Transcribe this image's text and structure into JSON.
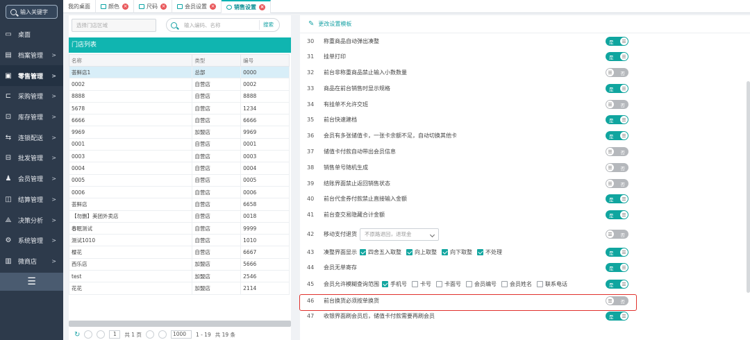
{
  "sidebar": {
    "search_placeholder": "输入关键字",
    "items": [
      {
        "label": "桌面",
        "icon": "desktop-icon",
        "arrow": ""
      },
      {
        "label": "档案管理",
        "icon": "file-icon",
        "arrow": ">"
      },
      {
        "label": "零售管理",
        "icon": "store-icon",
        "arrow": ">"
      },
      {
        "label": "采购管理",
        "icon": "purchase-icon",
        "arrow": ">"
      },
      {
        "label": "库存管理",
        "icon": "inventory-icon",
        "arrow": ">"
      },
      {
        "label": "连锁配送",
        "icon": "delivery-icon",
        "arrow": ">"
      },
      {
        "label": "批发管理",
        "icon": "wholesale-icon",
        "arrow": ">"
      },
      {
        "label": "会员管理",
        "icon": "member-icon",
        "arrow": ">"
      },
      {
        "label": "结算管理",
        "icon": "settlement-icon",
        "arrow": ">"
      },
      {
        "label": "决策分析",
        "icon": "analysis-icon",
        "arrow": ">"
      },
      {
        "label": "系统管理",
        "icon": "gear-icon",
        "arrow": ">"
      },
      {
        "label": "微商店",
        "icon": "shop-icon",
        "arrow": ">"
      }
    ],
    "collapse_glyph": "☰"
  },
  "tabs": [
    {
      "label": "我的桌面",
      "closable": false
    },
    {
      "label": "颜色",
      "closable": true
    },
    {
      "label": "尺码",
      "closable": true
    },
    {
      "label": "会员设置",
      "closable": true
    },
    {
      "label": "销售设置",
      "closable": true
    }
  ],
  "left": {
    "store_select_placeholder": "选择门店区域",
    "search_placeholder": "输入编码、名称",
    "search_button": "搜索",
    "store_list_title": "门店列表",
    "columns": [
      "名称",
      "类型",
      "编号"
    ],
    "rows": [
      [
        "荟鲜店1",
        "总部",
        "0000"
      ],
      [
        "0002",
        "自营店",
        "0002"
      ],
      [
        "8888",
        "自营店",
        "8888"
      ],
      [
        "5678",
        "自营店",
        "1234"
      ],
      [
        "6666",
        "自营店",
        "6666"
      ],
      [
        "9969",
        "加盟店",
        "9969"
      ],
      [
        "0001",
        "自营店",
        "0001"
      ],
      [
        "0003",
        "自营店",
        "0003"
      ],
      [
        "0004",
        "自营店",
        "0004"
      ],
      [
        "0005",
        "自营店",
        "0005"
      ],
      [
        "0006",
        "自营店",
        "0006"
      ],
      [
        "荟鲜店",
        "自营店",
        "6658"
      ],
      [
        "【勿删】美团外卖店",
        "自营店",
        "0018"
      ],
      [
        "春眠测试",
        "自营店",
        "9999"
      ],
      [
        "测试1010",
        "自营店",
        "1010"
      ],
      [
        "樱花",
        "自营店",
        "6667"
      ],
      [
        "西乐店",
        "加盟店",
        "5666"
      ],
      [
        "test",
        "加盟店",
        "2546"
      ],
      [
        "花花",
        "加盟店",
        "2114"
      ]
    ],
    "pager": {
      "refresh": "↻",
      "page": "1",
      "total_pages_text": "共 1 页",
      "page_size": "1000",
      "range_text": "1 - 19",
      "total_text": "共 19 条"
    }
  },
  "right": {
    "header": "更改设置模板",
    "toggle_on": "是",
    "toggle_off": "否",
    "settings": [
      {
        "num": "30",
        "label": "称重商品自动弹出凑整",
        "on": true
      },
      {
        "num": "31",
        "label": "挂单打印",
        "on": true
      },
      {
        "num": "32",
        "label": "前台非称重商品禁止输入小数数量",
        "on": false
      },
      {
        "num": "33",
        "label": "商品在前台销售时显示规格",
        "on": true
      },
      {
        "num": "34",
        "label": "有挂单不允许交班",
        "on": false
      },
      {
        "num": "35",
        "label": "前台快速建档",
        "on": true
      },
      {
        "num": "36",
        "label": "会员有多张储值卡，一张卡余额不足，自动切换其他卡",
        "on": true
      },
      {
        "num": "37",
        "label": "储值卡付款自动带出会员信息",
        "on": false
      },
      {
        "num": "38",
        "label": "销售单号随机生成",
        "on": false
      },
      {
        "num": "39",
        "label": "结账界面禁止返回销售状态",
        "on": false
      },
      {
        "num": "40",
        "label": "前台代金券付款禁止直接输入金额",
        "on": true
      },
      {
        "num": "41",
        "label": "前台查交易隐藏合计金额",
        "on": true
      },
      {
        "num": "42",
        "label": "移动支付退货",
        "on": false,
        "dropdown": "不原路退回，退现金"
      },
      {
        "num": "43",
        "label": "凑整界面显示",
        "on": true,
        "options": [
          {
            "label": "四舍五入取整",
            "checked": true
          },
          {
            "label": "向上取整",
            "checked": true
          },
          {
            "label": "向下取整",
            "checked": true
          },
          {
            "label": "不处理",
            "checked": true
          }
        ]
      },
      {
        "num": "44",
        "label": "会员无单寄存",
        "on": true
      },
      {
        "num": "45",
        "label": "会员允许模糊查询范围",
        "on": true,
        "options": [
          {
            "label": "手机号",
            "checked": true
          },
          {
            "label": "卡号",
            "checked": false
          },
          {
            "label": "卡面号",
            "checked": false
          },
          {
            "label": "会员编号",
            "checked": false
          },
          {
            "label": "会员姓名",
            "checked": false
          },
          {
            "label": "联系电话",
            "checked": false
          }
        ]
      },
      {
        "num": "46",
        "label": "前台换货必须按单换货",
        "on": false
      },
      {
        "num": "47",
        "label": "收银界面刷会员后，储值卡付款需要再刷会员",
        "on": true
      }
    ]
  }
}
